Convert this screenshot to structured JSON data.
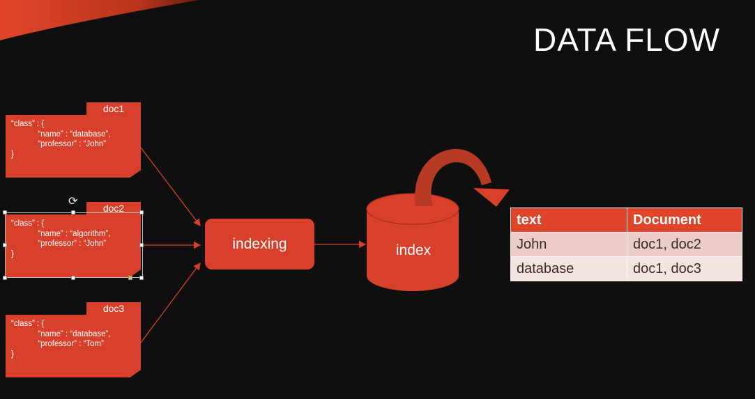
{
  "slide": {
    "title": "DATA FLOW"
  },
  "docs": [
    {
      "tab": "doc1",
      "lines": [
        "“class” : {",
        "            “name” : “database”,",
        "            “professor” : “John”",
        "}"
      ]
    },
    {
      "tab": "doc2",
      "lines": [
        "“class” : {",
        "            “name” : “algorithm”,",
        "            “professor” : “John”",
        "}"
      ]
    },
    {
      "tab": "doc3",
      "lines": [
        "“class” : {",
        "            “name” : “database”,",
        "            “professor” : “Tom”",
        "}"
      ]
    }
  ],
  "process": {
    "indexing_label": "indexing",
    "index_label": "index"
  },
  "result_table": {
    "headers": [
      "text",
      "Document"
    ],
    "rows": [
      [
        "John",
        "doc1, doc2"
      ],
      [
        "database",
        "doc1, doc3"
      ]
    ]
  },
  "colors": {
    "accent": "#d9402b",
    "background": "#0f0f0f"
  }
}
